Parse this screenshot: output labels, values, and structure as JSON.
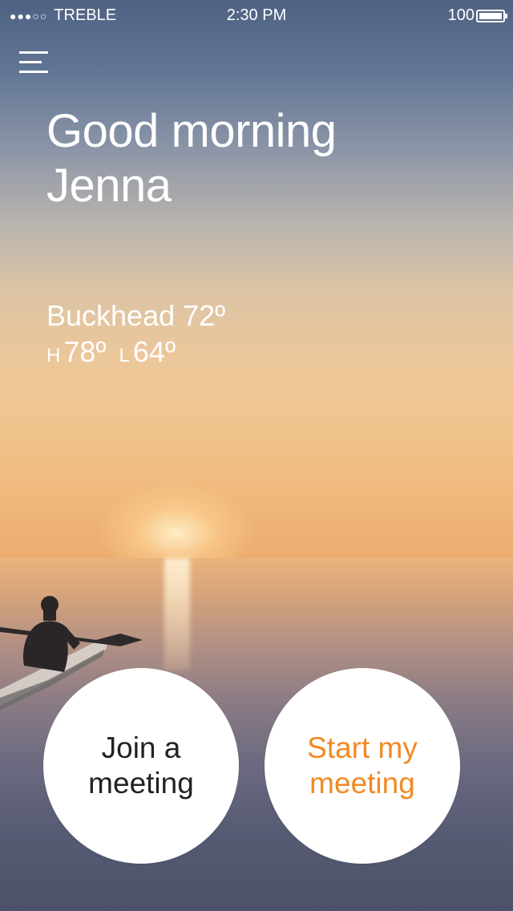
{
  "status_bar": {
    "signal_dots": "●●●○○",
    "carrier": "TREBLE",
    "time": "2:30 PM",
    "battery_text": "100"
  },
  "menu": {
    "icon": "hamburger-menu-icon"
  },
  "greeting": {
    "line1": "Good morning",
    "line2": "Jenna"
  },
  "weather": {
    "location_temp": "Buckhead 72º",
    "high_tag": "H",
    "high": "78º",
    "low_tag": "L",
    "low": "64º"
  },
  "actions": {
    "join_line1": "Join a",
    "join_line2": "meeting",
    "start_line1": "Start my",
    "start_line2": "meeting"
  },
  "colors": {
    "accent": "#f08a24",
    "button_bg": "#ffffff",
    "button_text": "#222222"
  }
}
